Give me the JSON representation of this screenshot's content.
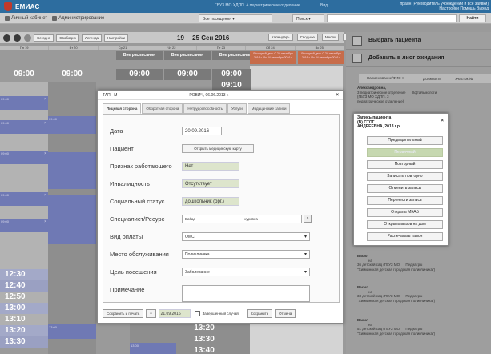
{
  "header": {
    "app_name": "ЕМИАС",
    "org": "ГБУЗ МО ХДПП. 4 педиатрическое отделение",
    "user_select": "Вид",
    "org_right_1": "пралн (Руководитель учреждений и все заявки)",
    "org_right_2": "Настройки  Помощь  Выход"
  },
  "menu": {
    "cabinet": "Личный кабинет",
    "admin": "Администрирование",
    "visits": "Все посещения ▾",
    "search_type": "Поиск ▾",
    "find": "Найти"
  },
  "calendar": {
    "today": "Сегодня",
    "free": "Свободно",
    "legend": "Легенда",
    "settings": "Настройки",
    "range": "19 —25 Сен 2016",
    "view_calendar": "Календарь",
    "view_summary": "Сводное",
    "view_month": "Месяц",
    "view_week": "Неделя",
    "view_day": "День",
    "days": [
      "Пн 19",
      "Вт 20",
      "Ср 21",
      "Чт 22",
      "Пт 23",
      "Сб 24",
      "Вс 25"
    ],
    "free_schedule": "Вне расписания",
    "holiday": "Выходной день С 24 сентября 2016 г. По 24 сентября 2016 г.",
    "times": [
      "09:00",
      "09:00",
      "09:00",
      "09:00",
      "09:00"
    ],
    "time_1010": "09:10",
    "bottom_times": [
      "12:30",
      "12:40",
      "12:50",
      "13:00",
      "13:10",
      "13:20",
      "13:30"
    ],
    "col_times": [
      "13:20",
      "13:30",
      "13:40"
    ],
    "slot_labels": [
      "09:00",
      "09:00",
      "09:00",
      "09:00",
      "09:00",
      "09:00",
      "13:00",
      "13:00"
    ]
  },
  "right_panel": {
    "select_patient": "Выбрать пациента",
    "waitlist": "Добавить в лист ожидания",
    "col_name": "Наименование/ФИО ▾",
    "col_position": "Должность",
    "col_site": "Участок №",
    "entries": [
      {
        "name": "Александровна,",
        "dept": "3 педиатрическое отделение",
        "detail": "(ГБУЗ МО ХДПП. 3",
        "extra": "педиатрическое отделение)",
        "role": "Офтальмологи"
      },
      {
        "name": "Васил",
        "dept": "на",
        "detail": "36 детский сад (ГБУЗ МО",
        "extra": "\"Химкинская детская городская поликлиника\")",
        "role": "Педиатры"
      },
      {
        "name": "Васил",
        "dept": "на",
        "detail": "33 детский сад (ГБУЗ МО",
        "extra": "\"Химкинская детская городская поликлиника\")",
        "role": "Педиатры"
      },
      {
        "name": "Васил",
        "dept": "на",
        "detail": "51 детский сад (ГБУЗ МО",
        "extra": "\"Химкинская детская городская поликлиника\")",
        "role": "Педиатры"
      }
    ]
  },
  "dialog": {
    "title": "ТАП - М",
    "subtitle": "РОВИЧ, 06.06.2013 г.",
    "close": "×",
    "tabs": [
      "Лицевая сторона",
      "Оборотная сторона",
      "Нетрудоспособность",
      "Услуги",
      "Медицинские записи"
    ],
    "fields": {
      "date_label": "Дата",
      "date_value": "20.09.2016",
      "patient_label": "Пациент",
      "open_card": "Открыть медицинскую карту",
      "worker_label": "Признак работающего",
      "worker_value": "Нет",
      "disability_label": "Инвалидность",
      "disability_value": "Отсутствует",
      "social_label": "Социальный статус",
      "social_value": "дошкольник (орг.)",
      "specialist_label": "Специалист/Ресурс",
      "specialist_value_1": "Бабад",
      "specialist_value_2": "куровна",
      "payment_label": "Вид оплаты",
      "payment_value": "ОМС",
      "place_label": "Место обслуживания",
      "place_value": "Поликлиника",
      "purpose_label": "Цель посещения",
      "purpose_value": "Заболевание",
      "note_label": "Примечание"
    },
    "footer": {
      "save_print": "Сохранить и печать",
      "dropdown": "▾",
      "date": "21.09.2016",
      "completed": "Завершенный случай",
      "save": "Сохранить",
      "cancel": "Отмена"
    }
  },
  "popup": {
    "title": "Запись пациента",
    "line2": "(В) СТОГ",
    "line3": "АНДРЕЕВНА, 2013 г.р.",
    "close": "×",
    "buttons": [
      "Предварительный",
      "Первичный",
      "Повторный",
      "Записать повторно",
      "Отменить запись",
      "Перенести запись",
      "Открыть МКАБ",
      "Открыть вызов на дом",
      "Распечатать талон"
    ]
  }
}
